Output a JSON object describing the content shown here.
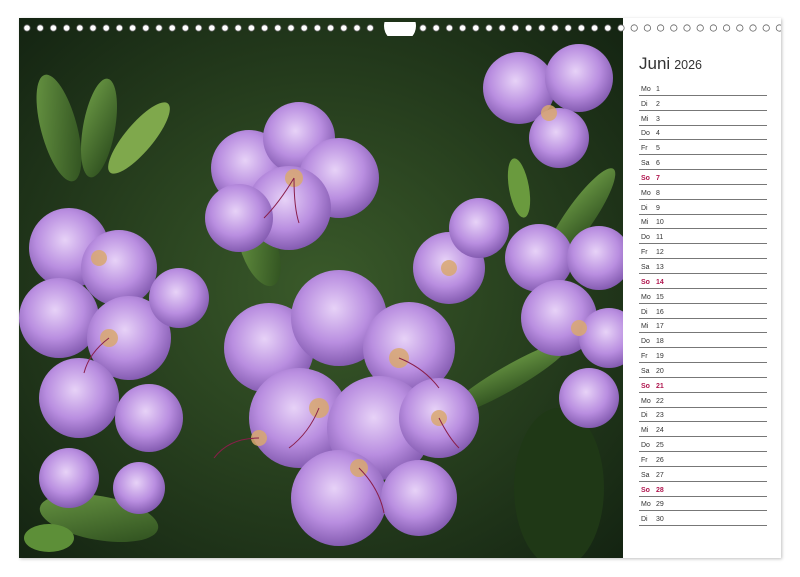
{
  "calendar": {
    "month": "Juni",
    "year": "2026",
    "sunday_color": "#b0174f",
    "days": [
      {
        "wd": "Mo",
        "d": "1",
        "sun": false
      },
      {
        "wd": "Di",
        "d": "2",
        "sun": false
      },
      {
        "wd": "Mi",
        "d": "3",
        "sun": false
      },
      {
        "wd": "Do",
        "d": "4",
        "sun": false
      },
      {
        "wd": "Fr",
        "d": "5",
        "sun": false
      },
      {
        "wd": "Sa",
        "d": "6",
        "sun": false
      },
      {
        "wd": "So",
        "d": "7",
        "sun": true
      },
      {
        "wd": "Mo",
        "d": "8",
        "sun": false
      },
      {
        "wd": "Di",
        "d": "9",
        "sun": false
      },
      {
        "wd": "Mi",
        "d": "10",
        "sun": false
      },
      {
        "wd": "Do",
        "d": "11",
        "sun": false
      },
      {
        "wd": "Fr",
        "d": "12",
        "sun": false
      },
      {
        "wd": "Sa",
        "d": "13",
        "sun": false
      },
      {
        "wd": "So",
        "d": "14",
        "sun": true
      },
      {
        "wd": "Mo",
        "d": "15",
        "sun": false
      },
      {
        "wd": "Di",
        "d": "16",
        "sun": false
      },
      {
        "wd": "Mi",
        "d": "17",
        "sun": false
      },
      {
        "wd": "Do",
        "d": "18",
        "sun": false
      },
      {
        "wd": "Fr",
        "d": "19",
        "sun": false
      },
      {
        "wd": "Sa",
        "d": "20",
        "sun": false
      },
      {
        "wd": "So",
        "d": "21",
        "sun": true
      },
      {
        "wd": "Mo",
        "d": "22",
        "sun": false
      },
      {
        "wd": "Di",
        "d": "23",
        "sun": false
      },
      {
        "wd": "Mi",
        "d": "24",
        "sun": false
      },
      {
        "wd": "Do",
        "d": "25",
        "sun": false
      },
      {
        "wd": "Fr",
        "d": "26",
        "sun": false
      },
      {
        "wd": "Sa",
        "d": "27",
        "sun": false
      },
      {
        "wd": "So",
        "d": "28",
        "sun": true
      },
      {
        "wd": "Mo",
        "d": "29",
        "sun": false
      },
      {
        "wd": "Di",
        "d": "30",
        "sun": false
      }
    ]
  },
  "photo": {
    "subject": "rhododendron-flowers",
    "flower_color": "#b98ee0",
    "leaf_color": "#3f6b2a"
  }
}
